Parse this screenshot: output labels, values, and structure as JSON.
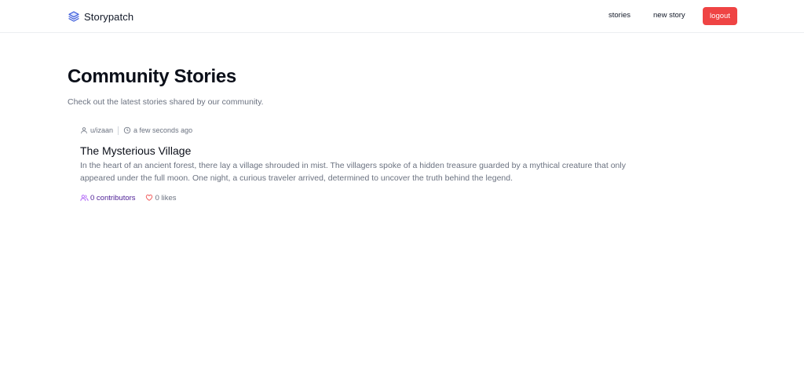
{
  "brand": {
    "name": "Storypatch",
    "icon": "layers-icon",
    "color": "#3b5bdb"
  },
  "nav": {
    "stories_label": "stories",
    "new_story_label": "new story",
    "logout_label": "logout",
    "logout_color": "#ef4444"
  },
  "header": {
    "title": "Community Stories",
    "subtitle": "Check out the latest stories shared by our community."
  },
  "stories": [
    {
      "author": "u/izaan",
      "timestamp": "a few seconds ago",
      "title": "The Mysterious Village",
      "excerpt": "In the heart of an ancient forest, there lay a village shrouded in mist. The villagers spoke of a hidden treasure guarded by a mythical creature that only appeared under the full moon. One night, a curious traveler arrived, determined to uncover the truth behind the legend.",
      "contributors_label": "0 contributors",
      "likes_label": "0 likes",
      "contributors_color": "#a855f7",
      "likes_color": "#ef4444"
    }
  ]
}
